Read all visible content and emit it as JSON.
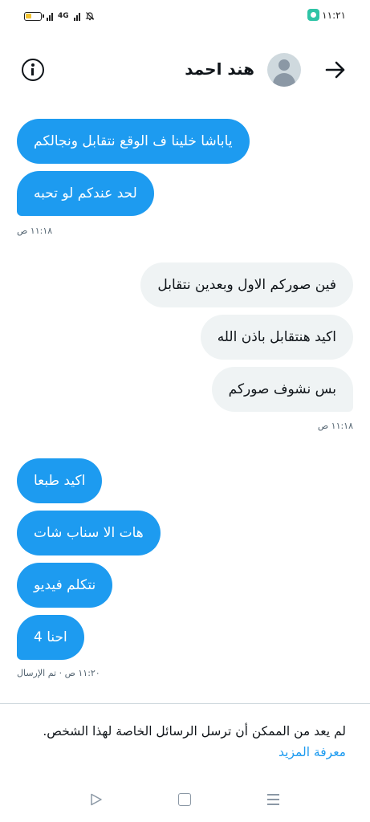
{
  "status_bar": {
    "time": "١١:٢١",
    "network_type": "4G"
  },
  "header": {
    "contact_name": "هند احمد"
  },
  "messages_group_1": {
    "bubble_1": "ياباشا خلينا ف الوقع نتقابل ونجالكم",
    "bubble_2": "لحد عندكم لو تحبه",
    "timestamp": "١١:١٨ ص"
  },
  "messages_group_2": {
    "bubble_1": "فين صوركم الاول وبعدين نتقابل",
    "bubble_2": "اكيد هنتقابل باذن الله",
    "bubble_3": "بس نشوف صوركم",
    "timestamp": "١١:١٨ ص"
  },
  "messages_group_3": {
    "bubble_1": "اكيد طبعا",
    "bubble_2": "هات الا سناب شات",
    "bubble_3": "نتكلم فيديو",
    "bubble_4": "احنا 4",
    "timestamp": "١١:٢٠ ص · تم الإرسال"
  },
  "footer_notice": {
    "text": "لم يعد من الممكن أن ترسل الرسائل الخاصة لهذا الشخص.",
    "link": "معرفة المزيد"
  },
  "icons": {
    "info": "info-icon",
    "back": "arrow-right-icon",
    "avatar": "default-avatar-icon",
    "nav_back": "triangle-back-icon",
    "nav_home": "square-home-icon",
    "nav_recents": "menu-lines-icon"
  },
  "colors": {
    "accent": "#1d9bf0",
    "received_bubble": "#eff3f4",
    "text": "#0f1419",
    "muted": "#536471"
  }
}
